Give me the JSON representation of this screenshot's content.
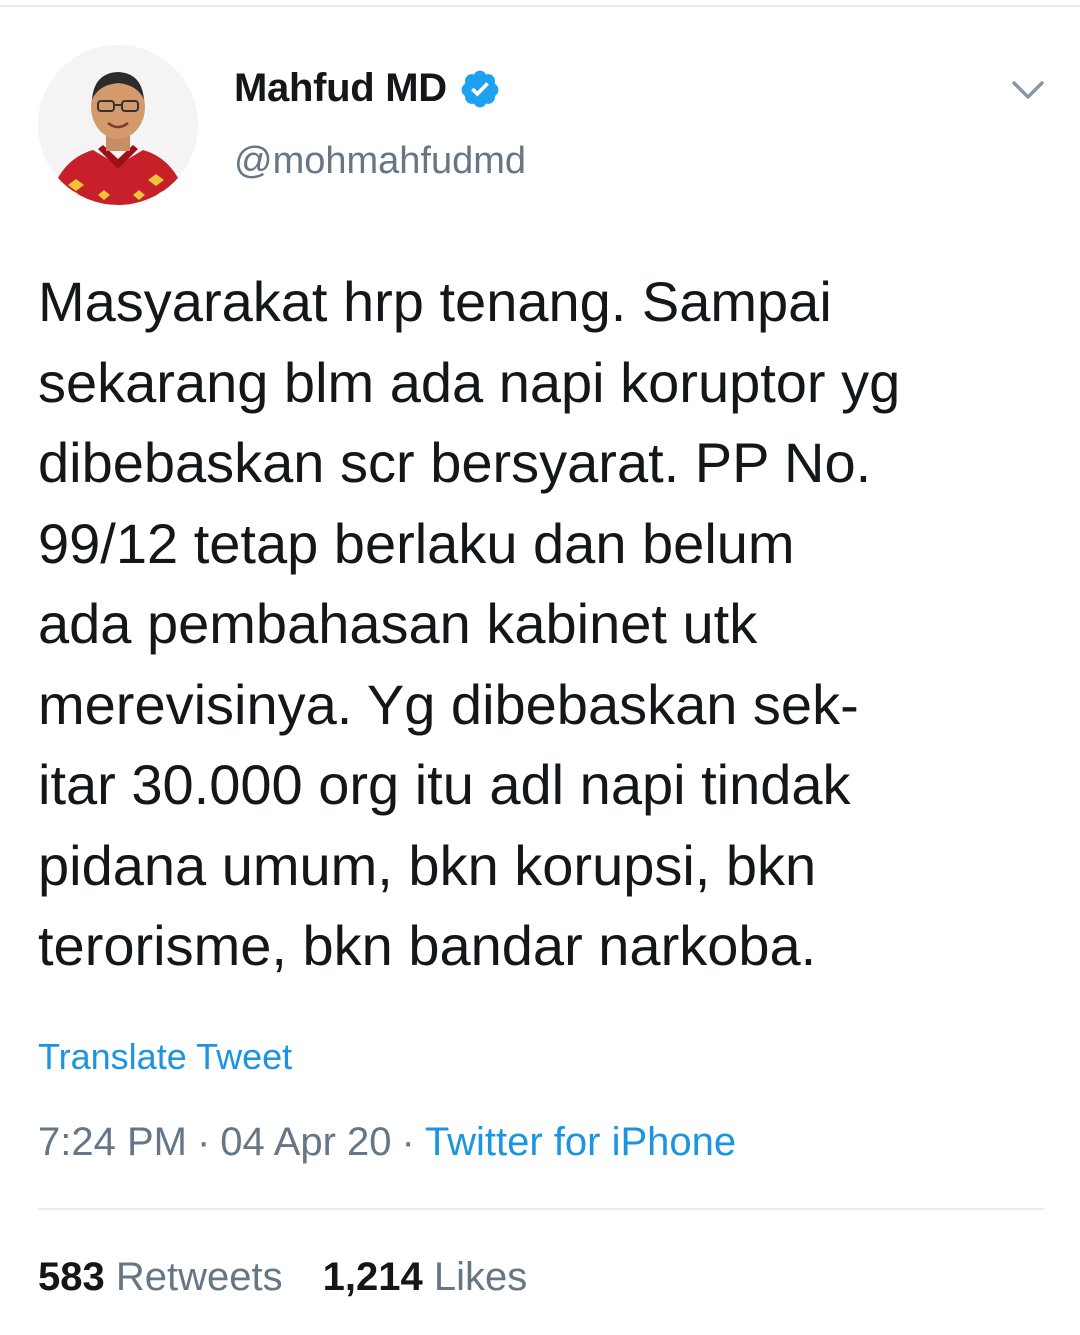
{
  "author": {
    "display_name": "Mahfud MD",
    "handle": "@mohmahfudmd",
    "verified": true,
    "avatar_icon": "profile-photo"
  },
  "tweet": {
    "lines": [
      "Masyarakat hrp tenang. Sampai",
      "sekarang blm ada napi koruptor yg",
      "dibebaskan scr bersyarat. PP No.",
      "99/12 tetap berlaku dan belum",
      "ada pembahasan kabinet utk",
      "merevisinya. Yg dibebaskan sek-",
      "itar 30.000 org itu adl napi tindak",
      "pidana umum, bkn korupsi, bkn",
      "terorisme, bkn bandar narkoba."
    ],
    "translate_label": "Translate Tweet",
    "time": "7:24 PM",
    "date": "04 Apr 20",
    "separator": "·",
    "source": "Twitter for iPhone"
  },
  "stats": {
    "retweets_count": "583",
    "retweets_label": "Retweets",
    "likes_count": "1,214",
    "likes_label": "Likes"
  },
  "colors": {
    "link": "#1b95e0",
    "verified": "#1da1f2",
    "secondary_text": "#657786",
    "primary_text": "#14171a",
    "divider": "#e6ecf0"
  }
}
